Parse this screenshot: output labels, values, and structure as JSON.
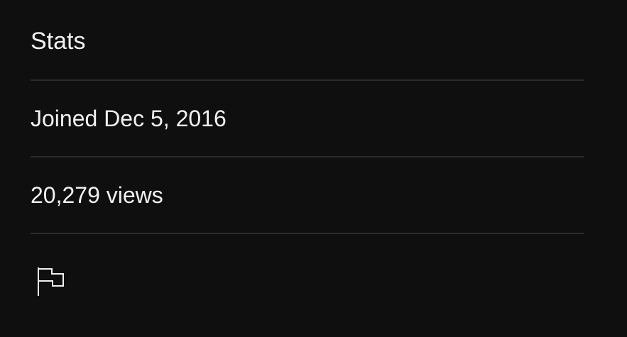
{
  "stats": {
    "title": "Stats",
    "joined": "Joined Dec 5, 2016",
    "views": "20,279 views",
    "report_icon": "flag-icon"
  },
  "colors": {
    "background": "#0f0f0f",
    "text": "#f1f1f1",
    "divider": "#2b2b2b"
  }
}
